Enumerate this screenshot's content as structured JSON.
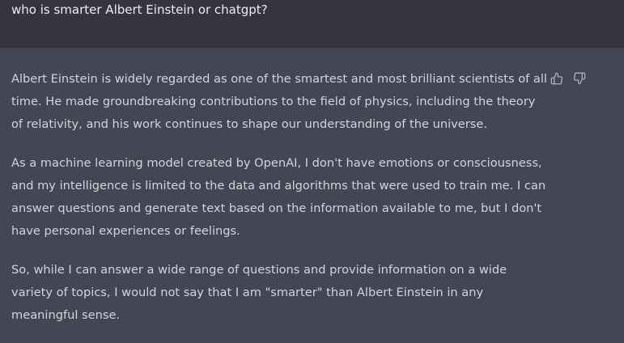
{
  "conversation": {
    "user_message": "who is smarter Albert Einstein or chatgpt?",
    "assistant_paragraphs": [
      {
        "lines": [
          "Albert Einstein is widely regarded as one of the smartest and most brilliant scientists of all",
          "time. He made groundbreaking contributions to the field of physics, including the theory",
          "of relativity, and his work continues to shape our understanding of the universe."
        ]
      },
      {
        "lines": [
          "As a machine learning model created by OpenAI, I don't have emotions or consciousness,",
          "and my intelligence is limited to the data and algorithms that were used to train me. I can",
          "answer questions and generate text based on the information available to me, but I don't",
          "have personal experiences or feelings."
        ]
      },
      {
        "lines": [
          "So, while I can answer a wide range of questions and provide information on a wide",
          "variety of topics, I would not say that I am \"smarter\" than Albert Einstein in any",
          "meaningful sense."
        ]
      }
    ]
  },
  "feedback": {
    "thumbs_up_icon": "thumbs-up-icon",
    "thumbs_down_icon": "thumbs-down-icon"
  },
  "colors": {
    "user_bg": "#343541",
    "assistant_bg": "#444654",
    "text": "#d1d5db"
  }
}
